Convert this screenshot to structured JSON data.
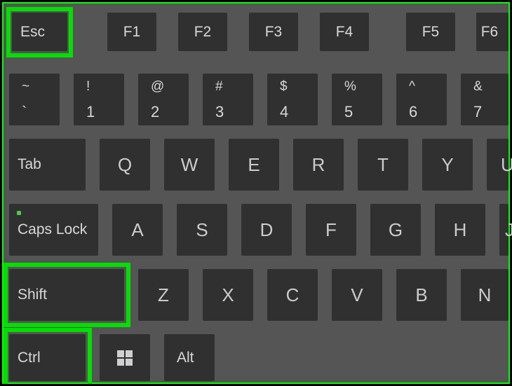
{
  "rows": {
    "fn": {
      "esc": "Esc",
      "f1": "F1",
      "f2": "F2",
      "f3": "F3",
      "f4": "F4",
      "f5": "F5",
      "f6": "F6"
    },
    "num": [
      {
        "upper": "~",
        "lower": "`"
      },
      {
        "upper": "!",
        "lower": "1"
      },
      {
        "upper": "@",
        "lower": "2"
      },
      {
        "upper": "#",
        "lower": "3"
      },
      {
        "upper": "$",
        "lower": "4"
      },
      {
        "upper": "%",
        "lower": "5"
      },
      {
        "upper": "^",
        "lower": "6"
      },
      {
        "upper": "&",
        "lower": "7"
      }
    ],
    "qwerty": {
      "tab": "Tab",
      "letters": [
        "Q",
        "W",
        "E",
        "R",
        "T",
        "Y",
        "U"
      ]
    },
    "asdf": {
      "caps": "Caps Lock",
      "letters": [
        "A",
        "S",
        "D",
        "F",
        "G",
        "H",
        "J"
      ]
    },
    "zxcv": {
      "shift": "Shift",
      "letters": [
        "Z",
        "X",
        "C",
        "V",
        "B",
        "N"
      ]
    },
    "bottom": {
      "ctrl": "Ctrl",
      "win": "windows-icon",
      "alt": "Alt"
    }
  },
  "highlights": {
    "esc": true,
    "shift": true,
    "ctrl": true
  },
  "colors": {
    "highlight": "#00e000",
    "key_bg": "#303030",
    "board_bg": "#555555",
    "text": "#d8d8d8"
  }
}
